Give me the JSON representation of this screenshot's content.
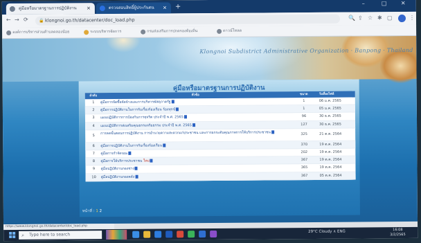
{
  "browser": {
    "tabs": [
      {
        "label": "คู่มือหรือมาตรฐานการปฏิบัติงาน",
        "active": true
      },
      {
        "label": "ตรวจสอบสิทธิ์ผู้ประกันตน",
        "active": false
      }
    ],
    "new_tab": "+",
    "url": "klongnoi.go.th/datacenter/doc_load.php",
    "bookmarks": [
      "องค์การบริหารส่วนตำบลคลองน้อย",
      "ระบบบริหารจัดการ",
      "กรมส่งเสริมการปกครองท้องถิ่น",
      "ดาวน์โหลด"
    ],
    "win_controls": [
      "–",
      "□",
      "✕"
    ]
  },
  "site": {
    "title": "Klongnoi Subdistrict Administrative Organization · Banpong · Thailand",
    "heading": "คู่มือหรือมาตรฐานการปฏิบัติงาน"
  },
  "table": {
    "headers": {
      "no": "ลำดับ",
      "title": "หัวข้อ",
      "size": "ขนาด",
      "date": "วันที่ลงไฟล์"
    },
    "rows": [
      {
        "no": "1",
        "title": "คู่มือการจัดซื้อจัดจ้างและการบริหารพัสดุภาครัฐ",
        "size": "1",
        "date": "06 ม.ค. 2565"
      },
      {
        "no": "2",
        "title": "คู่มือการปฏิบัติงานในการรับเรื่องร้องเรียน ร้องทุกข์",
        "size": "1",
        "date": "05 ม.ค. 2565"
      },
      {
        "no": "3",
        "title": "แผนปฏิบัติการการป้องกันการทุจริต ประจำปี พ.ศ. 2565",
        "size": "96",
        "date": "30 ธ.ค. 2565"
      },
      {
        "no": "4",
        "title": "แผนปฏิบัติการส่งเสริมคุณธรรมจริยธรรม ประจำปี พ.ศ. 2565",
        "size": "127",
        "date": "30 ธ.ค. 2565"
      },
      {
        "no": "5",
        "title": "การลดขั้นตอนการปฏิบัติงาน การอำนวยความสะดวกแก่ประชาชน และการยกระดับคุณภาพการให้บริการประชาชน",
        "size": "325",
        "date": "21 ต.ค. 2564"
      },
      {
        "no": "6",
        "title": "คู่มือการปฏิบัติงานในการรับเรื่องร้องเรียน",
        "size": "370",
        "date": "19 ต.ค. 2564"
      },
      {
        "no": "7",
        "title": "คู่มือการกำจัดขยะ",
        "size": "202",
        "date": "19 ต.ค. 2564"
      },
      {
        "no": "8",
        "title": "คู่มือการให้บริการประชาชน",
        "highlight": "ใหม่",
        "size": "367",
        "date": "19 ต.ค. 2564"
      },
      {
        "no": "9",
        "title": "คู่มือปฏิบัติงานกองช่าง",
        "size": "365",
        "date": "19 ต.ค. 2564"
      },
      {
        "no": "10",
        "title": "คู่มือปฏิบัติงานกองคลัง",
        "size": "367",
        "date": "05 ต.ค. 2564"
      }
    ]
  },
  "pager": {
    "label": "หน้าที่",
    "pages": [
      "1",
      "2"
    ],
    "current": "1"
  },
  "status_url": "https://www.klongnoi.go.th/datacenter/doc_load.php",
  "taskbar": {
    "search_placeholder": "Type here to search",
    "tray_text": "29°C Cloudy  ∧  ENG",
    "time": "16:08",
    "date": "3/2/2565"
  },
  "colors": {
    "tabbar": "#143a6a",
    "table_header": "#2f6fb7",
    "heading": "#2a6cb0",
    "pager_current": "#f3d14f"
  }
}
